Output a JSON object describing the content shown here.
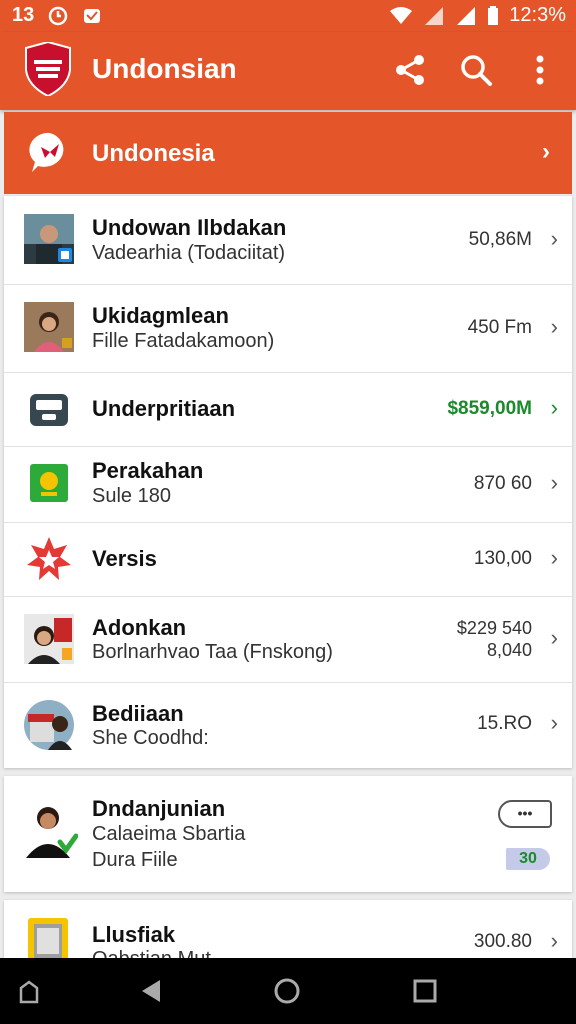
{
  "status_bar": {
    "left_text": "13",
    "time": "12:3%",
    "colors": {
      "bg": "#e4562a",
      "fg": "#ffffff"
    }
  },
  "app_bar": {
    "title": "Undonsian",
    "actions": [
      "share-icon",
      "search-icon",
      "more-vert-icon"
    ]
  },
  "banner": {
    "title": "Undonesia",
    "chevron": "›"
  },
  "list": [
    {
      "title": "Undowan Ilbdakan",
      "subtitle": "Vadearhia (Todaciitat)",
      "value": "50,86M",
      "chevron": "›"
    },
    {
      "title": "Ukidagmlean",
      "subtitle": "Fille Fatadakamoon)",
      "value": "450 Fm",
      "chevron": "›"
    },
    {
      "title": "Underpritiaan",
      "subtitle": "",
      "value": "$859,00M",
      "value_color": "#1a8a2a",
      "chevron": "›"
    },
    {
      "title": "Perakahan",
      "subtitle": "Sule 180",
      "value": "870 60",
      "chevron": "›"
    },
    {
      "title": "Versis",
      "subtitle": "",
      "value": "130,00",
      "chevron": "›"
    },
    {
      "title": "Adonkan",
      "subtitle": "Borlnarhvao Taa (Fnskong)",
      "value": "$229 540",
      "value2": "8,040",
      "chevron": "›"
    },
    {
      "title": "Bediiaan",
      "subtitle": "She Coodhd:",
      "value": "15.RO",
      "chevron": "›"
    }
  ],
  "featured": {
    "title": "Dndanjunian",
    "subtitle1": "Calaeima Sbartia",
    "subtitle2": "Dura Fiile",
    "badge": "30",
    "more_button": "•••"
  },
  "last_item": {
    "title": "Llusfiak",
    "subtitle": "Oabstian Mut",
    "value": "300.80",
    "chevron": "›"
  },
  "navbar": {
    "items": [
      "back-icon",
      "home-icon",
      "recents-icon"
    ]
  },
  "colors": {
    "accent": "#e4562a",
    "positive": "#1a8a2a"
  }
}
